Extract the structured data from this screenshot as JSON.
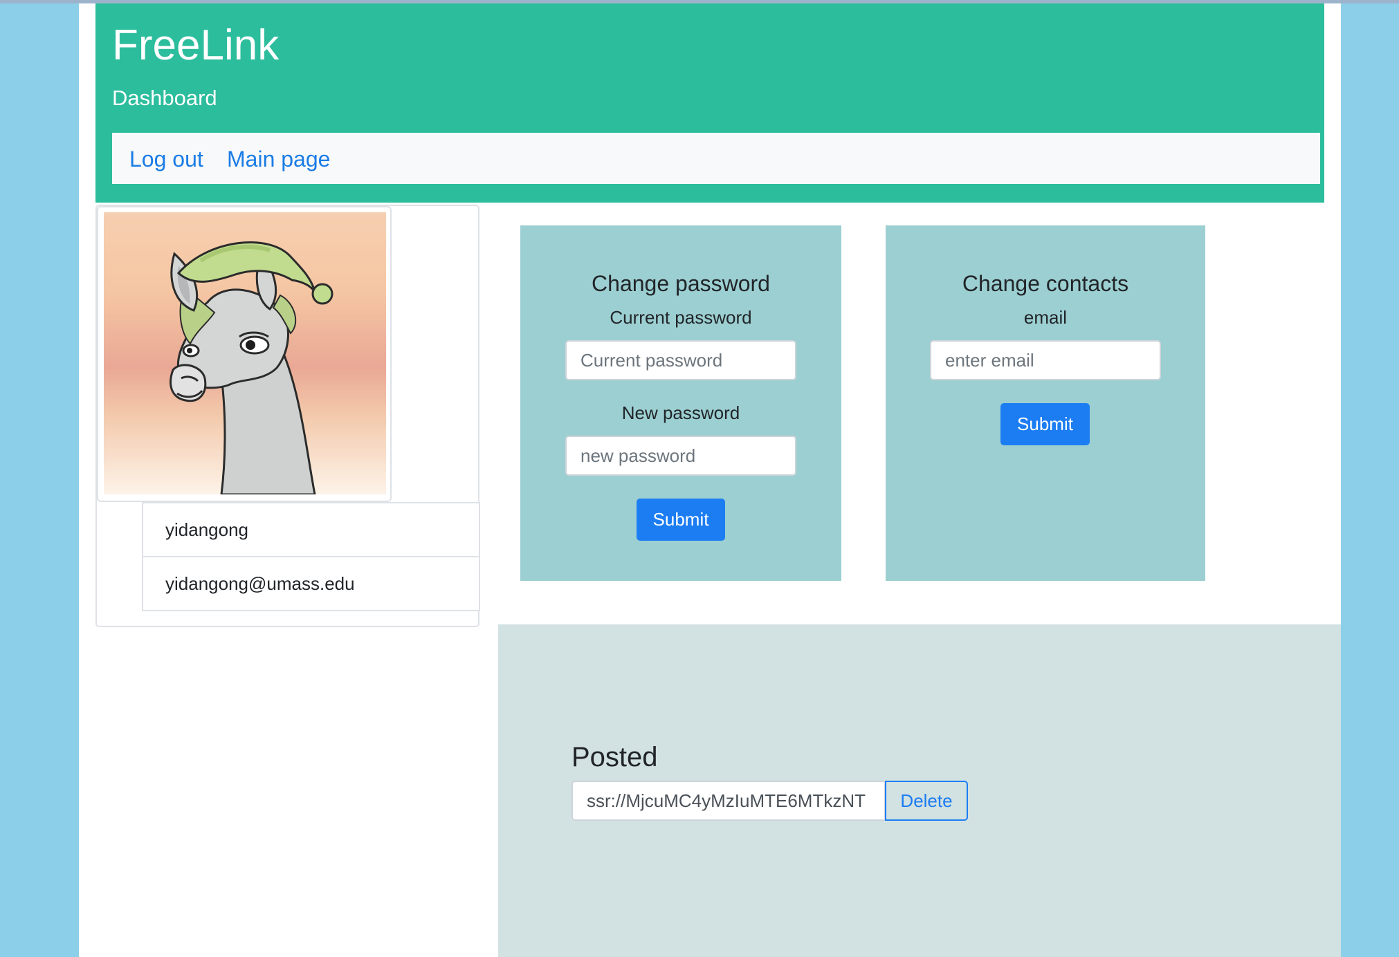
{
  "header": {
    "brand": "FreeLink",
    "subtitle": "Dashboard"
  },
  "nav": {
    "logout_label": "Log out",
    "main_page_label": "Main page"
  },
  "profile": {
    "avatar_icon": "llama-with-sleeping-cap-avatar",
    "username": "yidangong",
    "email": "yidangong@umass.edu"
  },
  "change_password": {
    "title": "Change password",
    "current_label": "Current password",
    "current_placeholder": "Current password",
    "new_label": "New password",
    "new_placeholder": "new password",
    "submit_label": "Submit"
  },
  "change_contacts": {
    "title": "Change contacts",
    "email_label": "email",
    "email_placeholder": "enter email",
    "submit_label": "Submit"
  },
  "posted": {
    "title": "Posted",
    "link_value": "ssr://MjcuMC4yMzIuMTE6MTkzNT",
    "delete_label": "Delete"
  },
  "colors": {
    "page_background": "#8ccfe9",
    "header": "#2cbd9d",
    "panel": "#9ccfd1",
    "posted_section": "#d2e1e1",
    "primary": "#1c7df3",
    "link": "#1a7ce6"
  }
}
